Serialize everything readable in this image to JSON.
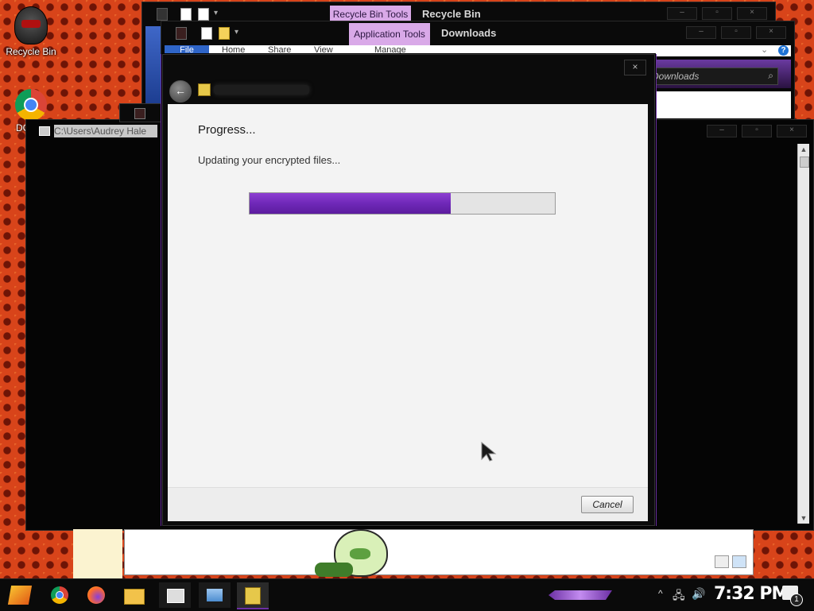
{
  "desktop": {
    "icons": [
      {
        "label": "Recycle Bin",
        "icon": "recycle-bin-icon"
      },
      {
        "label": "DC",
        "icon": "chrome-icon"
      }
    ]
  },
  "windows": {
    "recycle_bin": {
      "context_tab": "Recycle Bin Tools",
      "title": "Recycle Bin"
    },
    "downloads": {
      "context_tab": "Application Tools",
      "title": "Downloads",
      "ribbon_tabs": [
        "File",
        "Home",
        "Share",
        "View",
        "Manage"
      ],
      "search_placeholder": "Downloads"
    },
    "cmd": {
      "path": "C:\\Users\\Audrey Hale"
    }
  },
  "dialog": {
    "heading": "Progress...",
    "message": "Updating your encrypted files...",
    "progress": 0.66,
    "cancel_label": "Cancel",
    "close_label": "×"
  },
  "taskbar": {
    "clock": "7:32 PM",
    "notification_count": "1",
    "accent": "#6b2fa3"
  },
  "colors": {
    "progress_fill": "#7a2fc2",
    "context_tab": "#d9a9e8",
    "desktop_bg": "#d8441a"
  }
}
